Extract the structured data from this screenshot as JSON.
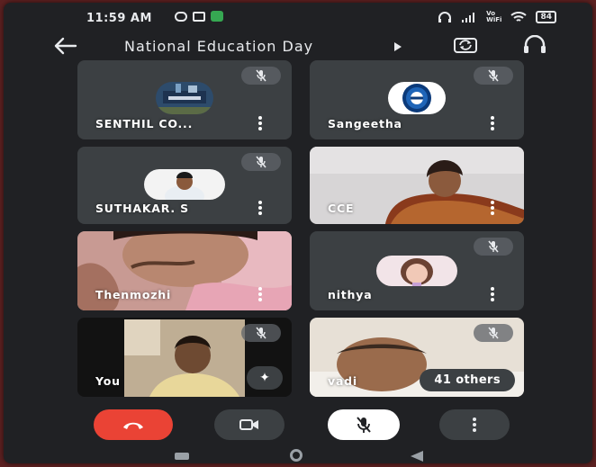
{
  "status_bar": {
    "time": "11:59 AM",
    "network": "Vo\nWiFi",
    "battery": "84"
  },
  "header": {
    "title": "National Education Day",
    "icons": [
      "back-arrow-icon",
      "play-arrow-icon",
      "flip-camera-icon",
      "headphones-icon"
    ]
  },
  "participants": [
    {
      "name": "SENTHIL CO...",
      "muted": true,
      "display": "avatar"
    },
    {
      "name": "Sangeetha",
      "muted": true,
      "display": "avatar"
    },
    {
      "name": "SUTHAKAR. S",
      "muted": true,
      "display": "avatar"
    },
    {
      "name": "CCE",
      "muted": false,
      "display": "video"
    },
    {
      "name": "Thenmozhi",
      "muted": false,
      "display": "video"
    },
    {
      "name": "nithya",
      "muted": true,
      "display": "avatar"
    },
    {
      "name": "You",
      "muted": true,
      "display": "video"
    },
    {
      "name": "vadi",
      "muted": true,
      "display": "video"
    }
  ],
  "others_label": "41 others",
  "controls": [
    "end-call",
    "camera",
    "microphone-muted",
    "more-options"
  ],
  "colors": {
    "background": "#202124",
    "tile": "#3c4043",
    "end_call": "#ea4335",
    "mic_button": "#ffffff"
  }
}
